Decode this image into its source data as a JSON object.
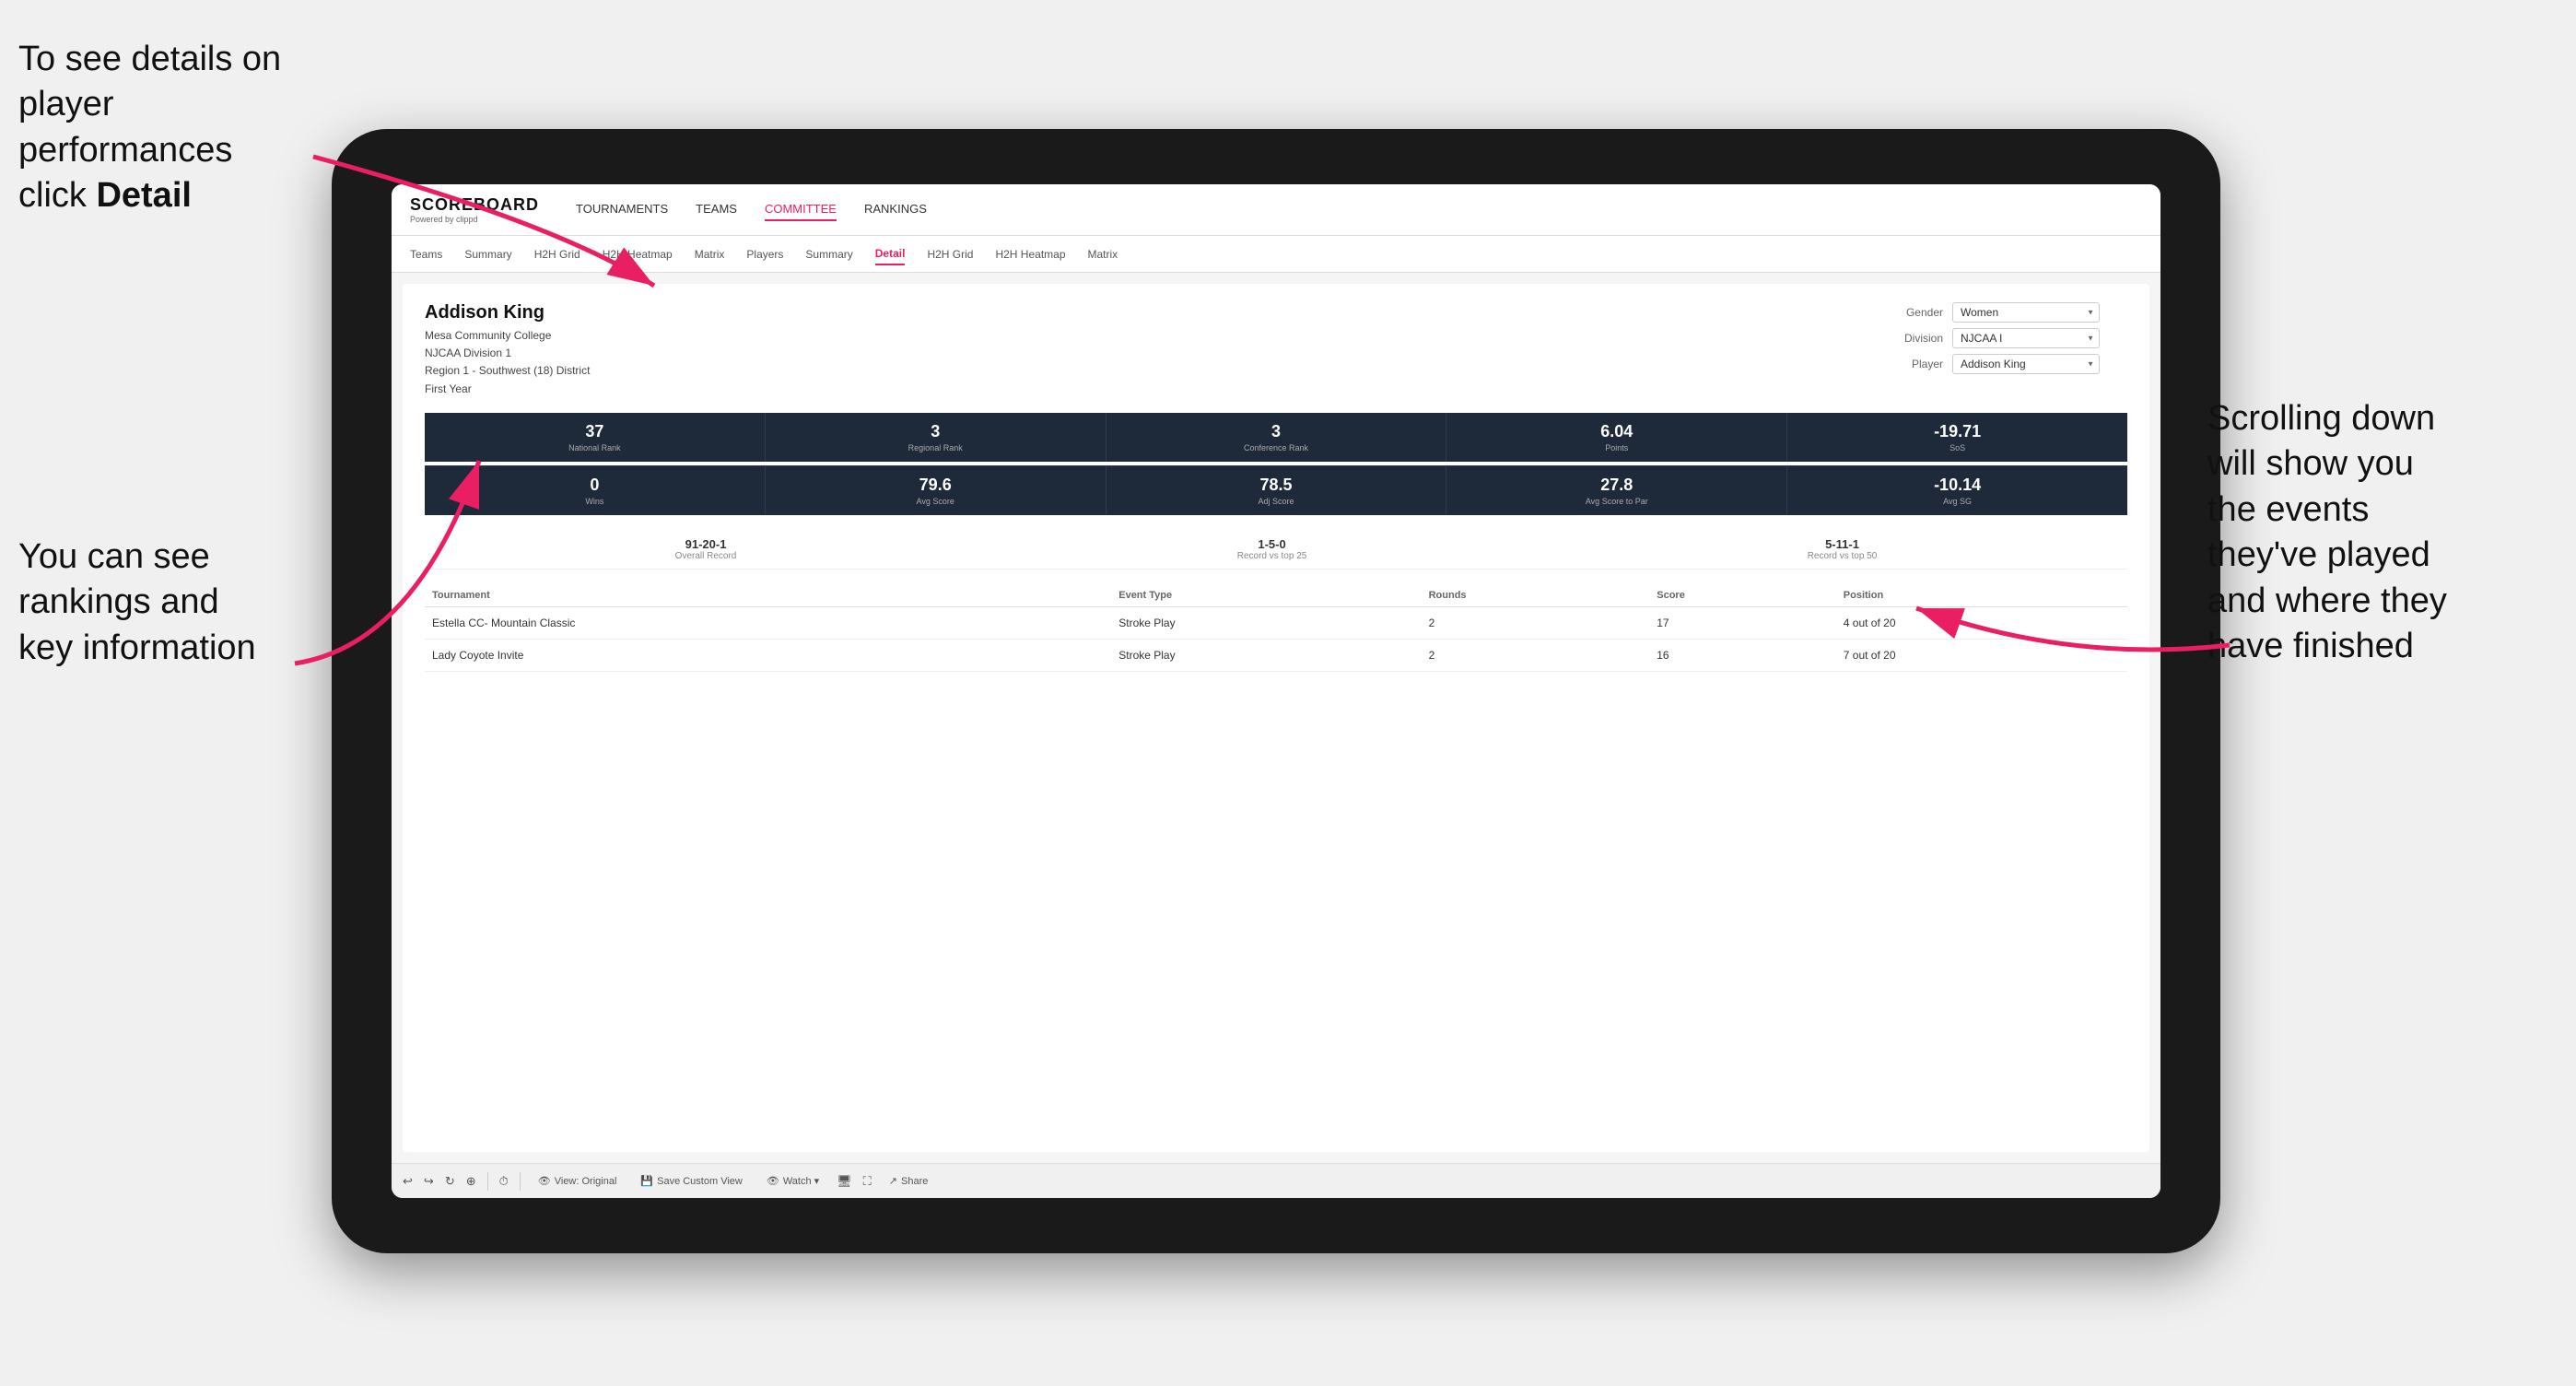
{
  "annotations": {
    "topleft": {
      "line1": "To see details on",
      "line2": "player performances",
      "line3_prefix": "click ",
      "line3_bold": "Detail"
    },
    "bottomleft": {
      "line1": "You can see",
      "line2": "rankings and",
      "line3": "key information"
    },
    "right": {
      "line1": "Scrolling down",
      "line2": "will show you",
      "line3": "the events",
      "line4": "they've played",
      "line5": "and where they",
      "line6": "have finished"
    }
  },
  "nav": {
    "logo": "SCOREBOARD",
    "logo_sub": "Powered by clippd",
    "links": [
      "TOURNAMENTS",
      "TEAMS",
      "COMMITTEE",
      "RANKINGS"
    ],
    "active_link": "COMMITTEE"
  },
  "subnav": {
    "links": [
      "Teams",
      "Summary",
      "H2H Grid",
      "H2H Heatmap",
      "Matrix",
      "Players",
      "Summary",
      "Detail",
      "H2H Grid",
      "H2H Heatmap",
      "Matrix"
    ],
    "active_link": "Detail"
  },
  "player": {
    "name": "Addison King",
    "school": "Mesa Community College",
    "division": "NJCAA Division 1",
    "region": "Region 1 - Southwest (18) District",
    "year": "First Year"
  },
  "controls": {
    "gender_label": "Gender",
    "gender_value": "Women",
    "division_label": "Division",
    "division_value": "NJCAA I",
    "player_label": "Player",
    "player_value": "Addison King"
  },
  "stats_row1": [
    {
      "value": "37",
      "label": "National Rank"
    },
    {
      "value": "3",
      "label": "Regional Rank"
    },
    {
      "value": "3",
      "label": "Conference Rank"
    },
    {
      "value": "6.04",
      "label": "Points"
    },
    {
      "value": "-19.71",
      "label": "SoS"
    }
  ],
  "stats_row2": [
    {
      "value": "0",
      "label": "Wins"
    },
    {
      "value": "79.6",
      "label": "Avg Score"
    },
    {
      "value": "78.5",
      "label": "Adj Score"
    },
    {
      "value": "27.8",
      "label": "Avg Score to Par"
    },
    {
      "value": "-10.14",
      "label": "Avg SG"
    }
  ],
  "records": [
    {
      "value": "91-20-1",
      "label": "Overall Record"
    },
    {
      "value": "1-5-0",
      "label": "Record vs top 25"
    },
    {
      "value": "5-11-1",
      "label": "Record vs top 50"
    }
  ],
  "table": {
    "headers": [
      "Tournament",
      "Event Type",
      "Rounds",
      "Score",
      "Position"
    ],
    "rows": [
      {
        "tournament": "Estella CC- Mountain Classic",
        "event_type": "Stroke Play",
        "rounds": "2",
        "score": "17",
        "position": "4 out of 20"
      },
      {
        "tournament": "Lady Coyote Invite",
        "event_type": "Stroke Play",
        "rounds": "2",
        "score": "16",
        "position": "7 out of 20"
      }
    ]
  },
  "toolbar": {
    "buttons": [
      "View: Original",
      "Save Custom View",
      "Watch ▾",
      "Share"
    ]
  }
}
